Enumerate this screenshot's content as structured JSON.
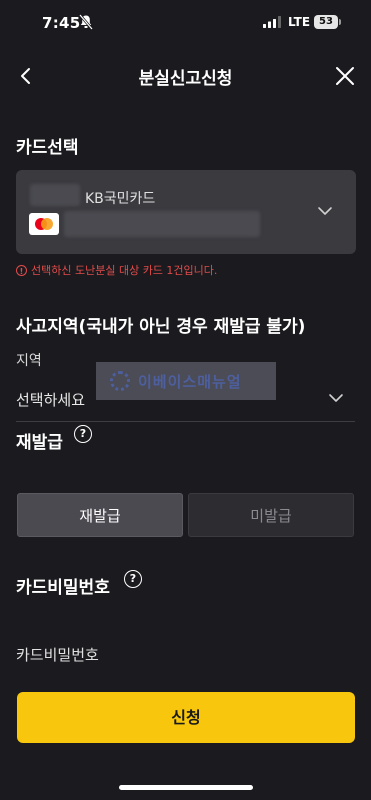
{
  "status_bar": {
    "time": "7:45",
    "network": "LTE",
    "battery": "53"
  },
  "header": {
    "title": "분실신고신청"
  },
  "card_section": {
    "title": "카드선택",
    "card_name": "KB국민카드",
    "warning": "선택하신 도난분실 대상 카드 1건입니다."
  },
  "region_section": {
    "title": "사고지역(국내가 아닌 경우 재발급 불가)",
    "label": "지역",
    "select_value": "선택하세요"
  },
  "watermark": {
    "text": "이베이스매뉴얼"
  },
  "reissue_section": {
    "title": "재발급",
    "options": [
      "재발급",
      "미발급"
    ],
    "selected": "재발급"
  },
  "password_section": {
    "title": "카드비밀번호",
    "placeholder": "카드비밀번호"
  },
  "submit": {
    "label": "신청"
  },
  "colors": {
    "background": "#1b1b1f",
    "accent": "#f7c60d",
    "warning": "#e24b4b"
  }
}
